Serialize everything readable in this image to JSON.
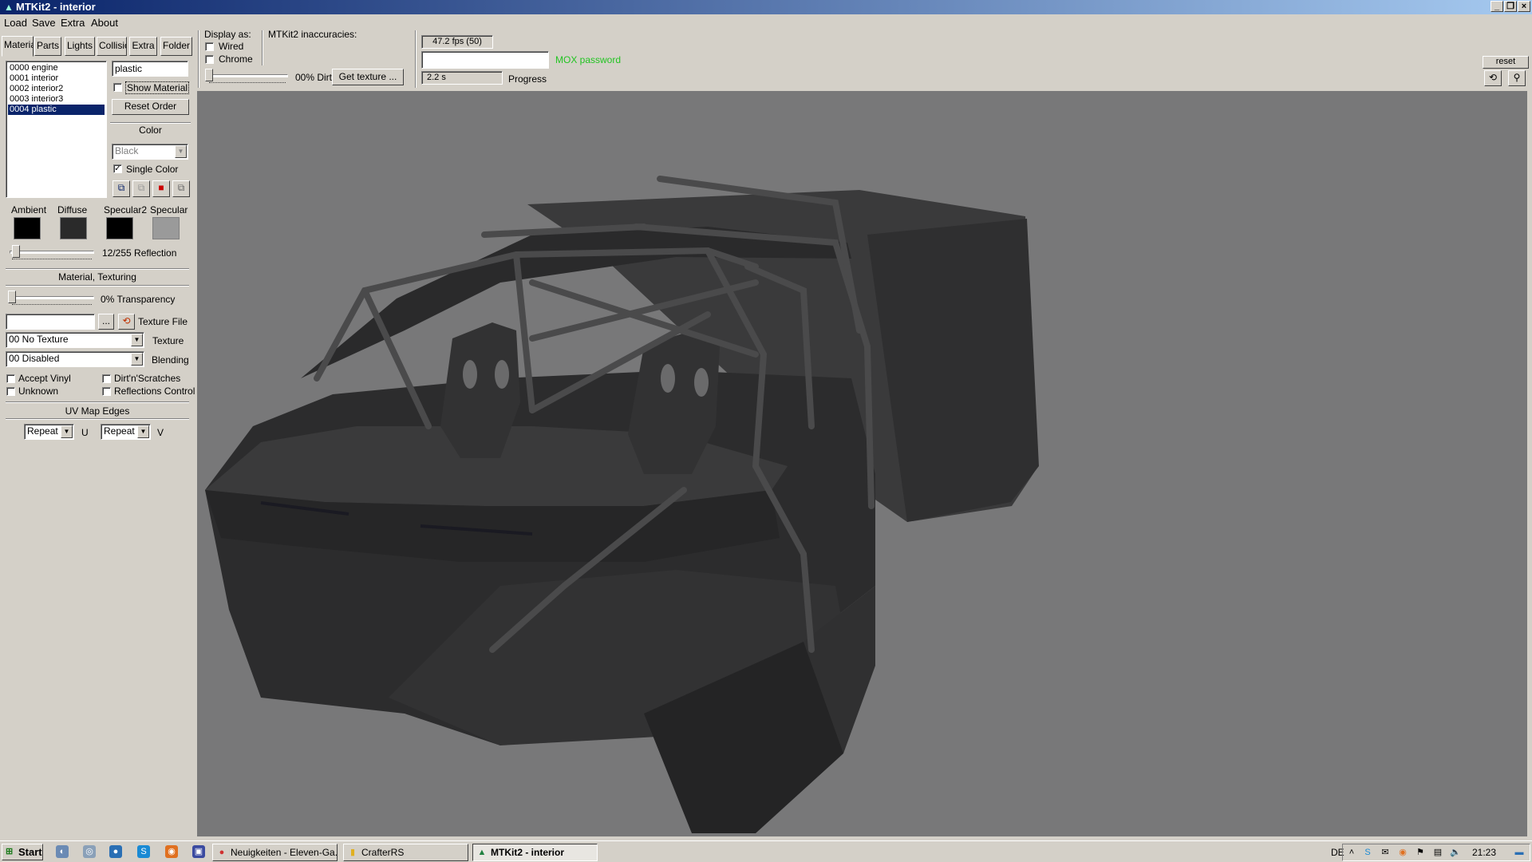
{
  "window": {
    "title": "MTKit2 - interior"
  },
  "menu": [
    "Load",
    "Save",
    "Extra",
    "About"
  ],
  "tabs": [
    "Materia",
    "Parts",
    "Lights",
    "Collisio",
    "Extra",
    "Folder"
  ],
  "materials": [
    "0000 engine",
    "0001 interior",
    "0002 interior2",
    "0003 interior3",
    "0004 plastic"
  ],
  "material_panel": {
    "name_value": "plastic",
    "show_material": "Show Material",
    "reset_order": "Reset Order",
    "color_heading": "Color",
    "color_value": "Black",
    "single_color": "Single Color",
    "swatch_labels": [
      "Ambient",
      "Diffuse",
      "Specular2",
      "Specular"
    ],
    "swatch_colors": [
      "#000000",
      "#2a2a2a",
      "#000000",
      "#9a9a9a"
    ],
    "reflection_label": "12/255 Reflection",
    "reflection_value": 12,
    "texturing_heading": "Material, Texturing",
    "transparency_label": "0% Transparency",
    "transparency_value": 0,
    "browse_button": "...",
    "texture_file_label": "Texture File",
    "texture_value": "00 No Texture",
    "texture_label": "Texture",
    "blending_value": "00 Disabled",
    "blending_label": "Blending",
    "accept_vinyl": "Accept Vinyl",
    "dirt_scratches": "Dirt'n'Scratches",
    "unknown": "Unknown",
    "reflections_control": "Reflections Control",
    "uv_heading": "UV Map Edges",
    "u_value": "Repeat",
    "u_label": "U",
    "v_value": "Repeat",
    "v_label": "V"
  },
  "toolbar": {
    "display_as": "Display as:",
    "wired": "Wired",
    "chrome": "Chrome",
    "dirt_label": "00% Dirt",
    "dirt_value": 0,
    "get_texture": "Get texture ...",
    "inaccuracies": "MTKit2 inaccuracies:",
    "fps": "47.2 fps (50)",
    "mox_password": "MOX password",
    "time": "2.2 s",
    "progress_label": "Progress",
    "reset": "reset"
  },
  "taskbar": {
    "start": "Start",
    "tasks": [
      "Neuigkeiten - Eleven-Ga...",
      "CrafterRS",
      "MTKit2 - interior"
    ],
    "language": "DE",
    "clock": "21:23"
  }
}
